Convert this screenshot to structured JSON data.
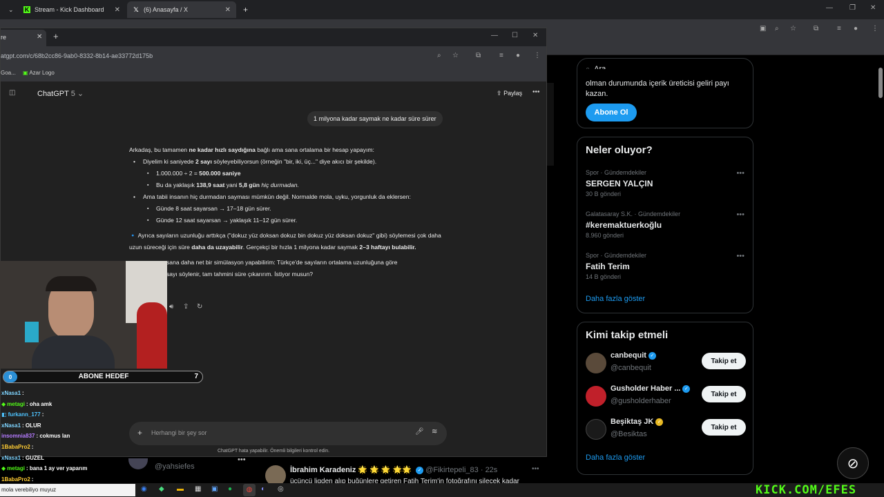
{
  "back_browser": {
    "tabs": [
      {
        "title": "Stream - Kick Dashboard",
        "icon": "kick-icon"
      },
      {
        "title": "(6) Anasayfa / X",
        "icon": "x-logo-icon"
      }
    ]
  },
  "x_sidebar": {
    "search_placeholder": "Ara",
    "premium": {
      "text_line1": "olman durumunda içerik üreticisi geliri payı",
      "text_line2": "kazan.",
      "button": "Abone Ol"
    },
    "trends_title": "Neler oluyor?",
    "trends": [
      {
        "meta": "Spor · Gündemdekiler",
        "name": "SERGEN YALÇIN",
        "count": "30 B gönderi"
      },
      {
        "meta": "Galatasaray S.K. · Gündemdekiler",
        "name": "#keremaktuerkoğlu",
        "count": "8.960 gönderi"
      },
      {
        "meta": "Spor · Gündemdekiler",
        "name": "Fatih Terim",
        "count": "14 B gönderi"
      }
    ],
    "show_more": "Daha fazla göster",
    "who_title": "Kimi takip etmeli",
    "who": [
      {
        "name": "canbequit",
        "handle": "@canbequit",
        "badge": "blue",
        "avatar_color": "#5a4a3a"
      },
      {
        "name": "Gusholder Haber ...",
        "handle": "@gusholderhaber",
        "badge": "blue",
        "avatar_color": "#c0202a"
      },
      {
        "name": "Beşiktaş JK",
        "handle": "@Besiktas",
        "badge": "gold",
        "avatar_color": "#1a1a1a"
      }
    ],
    "follow_label": "Takip et",
    "show_more_2": "Daha fazla göster"
  },
  "x_feed": {
    "left_handle": "@yahsiefes",
    "tweet_author": "İbrahim Karadeniz",
    "tweet_emojis": "🌟 🌟 🌟 🌟🌟",
    "tweet_handle": "@Fikirtepeli_83 · 22s",
    "tweet_text": "üçüncü ligden alıp buğünlere getiren Fatih Terim'in fotoğrafını silecek kadar"
  },
  "gpt_browser": {
    "tab_title": "re",
    "url": "atgpt.com/c/68b2cc86-9ab0-8332-8b14-ae33772d175b",
    "bookmarks": [
      "Goa...",
      "Azar Logo"
    ]
  },
  "gpt": {
    "model_label": "ChatGPT",
    "model_version": "5",
    "share_label": "Paylaş",
    "user_message": "1 milyona kadar saymak ne kadar süre sürer",
    "answer": {
      "intro_a": "Arkadaş, bu tamamen ",
      "intro_b": "ne kadar hızlı saydığına",
      "intro_c": " bağlı ama sana ortalama bir hesap yapayım:",
      "b1_a": "Diyelim ki saniyede ",
      "b1_b": "2 sayı",
      "b1_c": " söyleyebiliyorsun (örneğin \"bir, iki, üç...\" diye akıcı bir şekilde).",
      "b1s1_a": "1.000.000 ÷ 2 = ",
      "b1s1_b": "500.000 saniye",
      "b1s2_a": "Bu da yaklaşık ",
      "b1s2_b": "138,9 saat",
      "b1s2_c": " yani ",
      "b1s2_d": "5,8 gün",
      "b1s2_e": " hiç durmadan.",
      "b2": "Ama tabii insanın hiç durmadan sayması mümkün değil. Normalde mola, uyku, yorgunluk da eklersen:",
      "b2s1": "Günde 8 saat sayarsan → 17–18 gün sürer.",
      "b2s2": "Günde 12 saat sayarsan → yaklaşık 11–12 gün sürer.",
      "p2_a": " Ayrıca sayıların uzunluğu arttıkça (\"dokuz yüz doksan dokuz bin dokuz yüz doksan dokuz\" gibi) söylemesi çok daha uzun süreceği için süre ",
      "p2_b": "daha da uzayabilir",
      "p2_c": ". Gerçekçi bir hızla 1 milyona kadar saymak ",
      "p2_d": "2–3 haftayı bulabilir.",
      "p3_l1": "sana daha net bir simülasyon yapabilirim: Türkçe'de sayıların ortalama uzunluğuna göre",
      "p3_l2": "sayı söylenir, tam tahmini süre çıkarırım. İstiyor musun?"
    },
    "composer_placeholder": "Herhangi bir şey sor",
    "disclaimer": "ChatGPT hata yapabilir. Önemli bilgileri kontrol edin."
  },
  "stream": {
    "sub_goal_current": "0",
    "sub_goal_label": "ABONE HEDEF",
    "sub_goal_target": "7",
    "chat": [
      {
        "user": "xNasa1",
        "text": ":",
        "color": "#7fd4ff",
        "badge": ""
      },
      {
        "user": "metagi",
        "text": ": oha amk",
        "color": "#53fc18",
        "badge": "◆"
      },
      {
        "user": "furkann_177",
        "text": ":",
        "color": "#4ec3ff",
        "badge": "◧"
      },
      {
        "user": "xNasa1",
        "text": ": OLUR",
        "color": "#7fd4ff",
        "badge": ""
      },
      {
        "user": "insomnia837",
        "text": ": cokmus lan",
        "color": "#b57bff",
        "badge": ""
      },
      {
        "user": "1BabaPro2",
        "text": ":",
        "color": "#ffcc33",
        "badge": ""
      },
      {
        "user": "xNasa1",
        "text": ": GUZEL",
        "color": "#7fd4ff",
        "badge": ""
      },
      {
        "user": "metagi",
        "text": ": bana 1 ay ver yaparım",
        "color": "#53fc18",
        "badge": "◆"
      },
      {
        "user": "1BabaPro2",
        "text": ":",
        "color": "#ffcc33",
        "badge": ""
      }
    ],
    "watermark": "KICK.COM/EFES"
  },
  "taskbar": {
    "search_text": "mola verebiliyo muyuz"
  }
}
